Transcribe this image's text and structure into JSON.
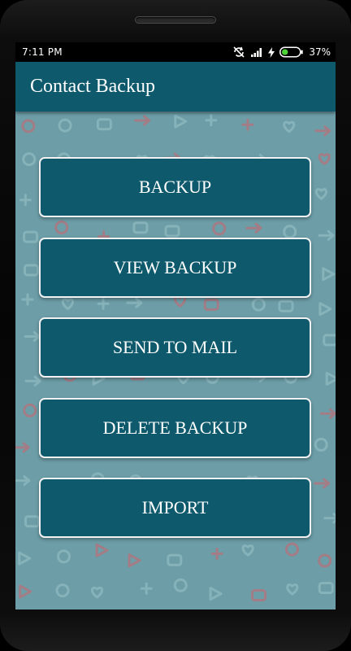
{
  "status_bar": {
    "time": "7:11 PM",
    "battery_percent": "37%",
    "battery_level": 0.37,
    "icons": [
      "sync-disabled-icon",
      "signal-icon",
      "charging-bolt-icon",
      "battery-icon"
    ],
    "battery_color": "#4cd137"
  },
  "app_bar": {
    "title": "Contact Backup",
    "color": "#0e5a6c"
  },
  "menu": {
    "buttons": [
      {
        "label": "BACKUP"
      },
      {
        "label": "VIEW BACKUP"
      },
      {
        "label": "SEND TO MAIL"
      },
      {
        "label": "DELETE BACKUP"
      },
      {
        "label": "IMPORT"
      }
    ]
  },
  "colors": {
    "background": "#6d9ea8",
    "button": "#0e5a6c",
    "button_border": "#f2f2f2",
    "pattern_light": "#8fb8c0",
    "pattern_red": "#b5707a"
  }
}
